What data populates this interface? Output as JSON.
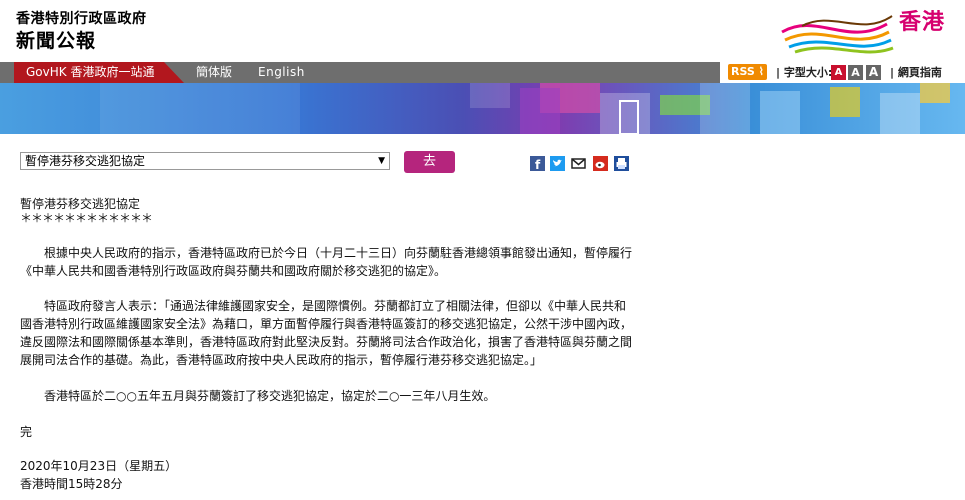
{
  "header": {
    "org_name": "香港特別行政區政府",
    "section_title": "新聞公報",
    "brand_text": "香港"
  },
  "nav": {
    "govhk": "GovHK 香港政府一站通",
    "simplified": "簡体版",
    "english": "English",
    "rss": "RSS",
    "font_size_label": "| 字型大小:",
    "font_small": "A",
    "font_medium": "A",
    "font_large": "A",
    "guide": "| 網頁指南"
  },
  "selector": {
    "selected": "暫停港芬移交逃犯協定",
    "go_label": "去"
  },
  "share_icons": [
    "facebook-icon",
    "twitter-icon",
    "email-icon",
    "weibo-icon",
    "print-icon"
  ],
  "article": {
    "title": "暫停港芬移交逃犯協定",
    "stars": "＊＊＊＊＊＊＊＊＊＊＊＊",
    "p1": [
      "　　根據中央人民政府的指示，香港特區政府已於今日（十月二十三日）向芬蘭駐香港總領事館發出通知，暫停履行",
      "《中華人民共和國香港特別行政區政府與芬蘭共和國政府關於移交逃犯的協定》。"
    ],
    "p2": [
      "　　特區政府發言人表示：「通過法律維護國家安全，是國際慣例。芬蘭都訂立了相關法律，但卻以《中華人民共和",
      "國香港特別行政區維護國家安全法》為藉口，單方面暫停履行與香港特區簽訂的移交逃犯協定，公然干涉中國內政，",
      "違反國際法和國際關係基本準則，香港特區政府對此堅決反對。芬蘭將司法合作政治化，損害了香港特區與芬蘭之間",
      "展開司法合作的基礎。為此，香港特區政府按中央人民政府的指示，暫停履行港芬移交逃犯協定。」"
    ],
    "p3": "　　香港特區於二○○五年五月與芬蘭簽訂了移交逃犯協定，協定於二○一三年八月生效。",
    "end": "完",
    "date": "2020年10月23日（星期五）",
    "time": "香港時間15時28分"
  },
  "colors": {
    "accent": "#b5257d",
    "govhk_red": "#b2171e",
    "nav_grey": "#6e6e6e",
    "rss_orange": "#f08a00"
  }
}
